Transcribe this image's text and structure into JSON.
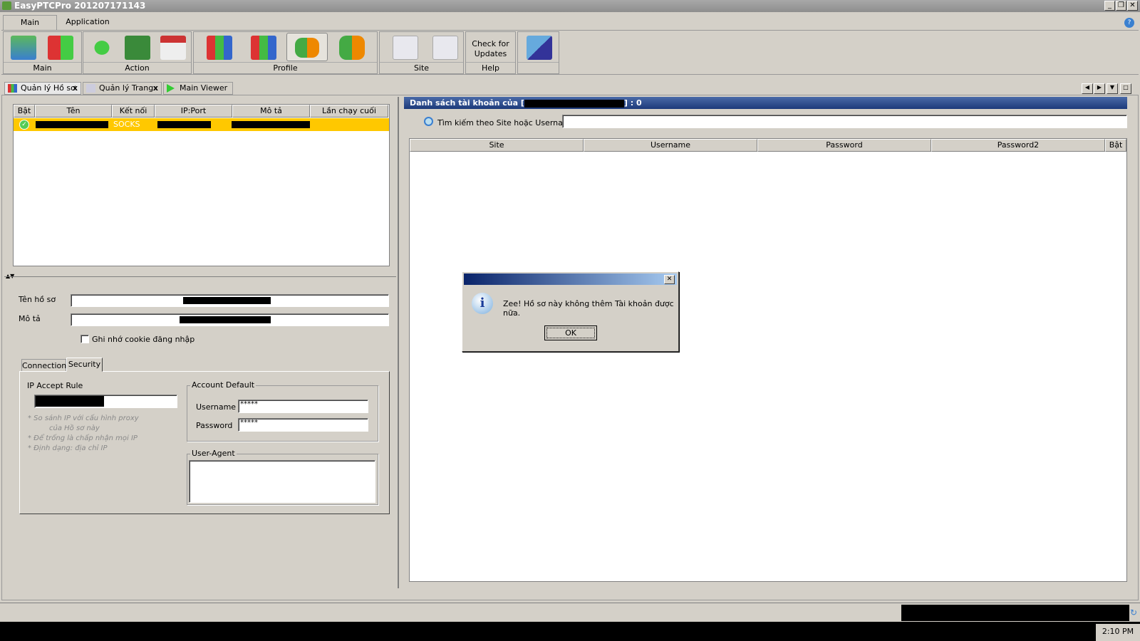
{
  "window": {
    "title": "EasyPTCPro 201207171143",
    "controls": [
      "_",
      "❐",
      "✕"
    ]
  },
  "ribbon": {
    "tabs": [
      "Main",
      "Application"
    ],
    "groups": [
      {
        "label": "Main"
      },
      {
        "label": "Action"
      },
      {
        "label": "Profile"
      },
      {
        "label": "Site"
      },
      {
        "label": "Help",
        "button": "Check for Updates"
      },
      {
        "label": ""
      }
    ]
  },
  "doc_tabs": [
    {
      "label": "Quản lý Hồ sơ",
      "close": "x"
    },
    {
      "label": "Quản lý Trang",
      "close": "x"
    },
    {
      "label": "Main Viewer"
    }
  ],
  "profiles": {
    "columns": [
      "Bật",
      "Tên",
      "Kết nối",
      "IP:Port",
      "Mô tả",
      "Lần chạy cuối"
    ],
    "rows": [
      {
        "connection": "SOCKS"
      }
    ]
  },
  "profile_form": {
    "name_label": "Tên hồ sơ",
    "desc_label": "Mô tả",
    "remember_cookie": "Ghi nhớ cookie đăng nhập",
    "tabs": [
      "Connection",
      "Security"
    ],
    "ip_rule_label": "IP Accept Rule",
    "notes": [
      "* So sánh IP với cấu hình proxy",
      "của Hồ sơ này",
      "* Để trống là chấp nhận mọi IP",
      "* Định dạng: địa chỉ IP"
    ],
    "account_default": {
      "legend": "Account Default",
      "username_label": "Username",
      "username": "*****",
      "password_label": "Password",
      "password": "*****"
    },
    "user_agent_legend": "User-Agent"
  },
  "accounts": {
    "title_prefix": "Danh sách tài khoản của [",
    "title_suffix": "] : 0",
    "search_label": "Tìm kiếm theo Site hoặc Username",
    "columns": [
      "Site",
      "Username",
      "Password",
      "Password2",
      "Bật"
    ]
  },
  "dialog": {
    "message": "Zee! Hồ sơ này không thêm Tài khoản được nữa.",
    "ok": "OK",
    "close": "✕"
  },
  "taskbar": {
    "clock": "2:10 PM"
  }
}
